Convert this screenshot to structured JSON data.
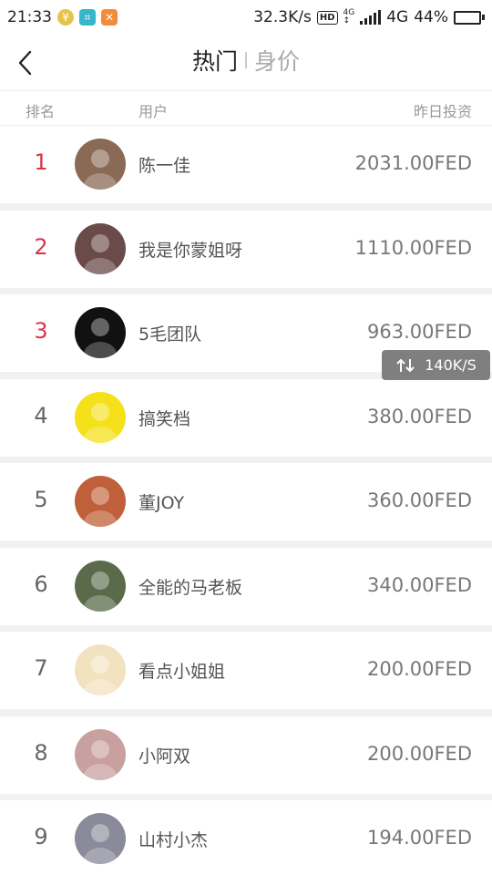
{
  "status": {
    "time": "21:33",
    "net_speed": "32.3K/s",
    "hd": "HD",
    "net_type": "4G",
    "battery": "44%",
    "battery_level": 0.44,
    "icons": [
      "coin-app-icon",
      "scan-app-icon",
      "tools-app-icon"
    ]
  },
  "header": {
    "tabs": [
      {
        "label": "热门",
        "active": true
      },
      {
        "label": "身价",
        "active": false
      }
    ]
  },
  "columns": {
    "rank": "排名",
    "user": "用户",
    "investment": "昨日投资"
  },
  "rows": [
    {
      "rank": "1",
      "name": "陈一佳",
      "amount": "2031.00FED",
      "avatar": "avatar-woman-icon",
      "avatar_color": "#8a6a55"
    },
    {
      "rank": "2",
      "name": "我是你蒙姐呀",
      "amount": "1110.00FED",
      "avatar": "avatar-woman-icon",
      "avatar_color": "#6b4a4a"
    },
    {
      "rank": "3",
      "name": "5毛团队",
      "amount": "963.00FED",
      "avatar": "logo-5mao-icon",
      "avatar_color": "#111111"
    },
    {
      "rank": "4",
      "name": "搞笑档",
      "amount": "380.00FED",
      "avatar": "logo-funny-icon",
      "avatar_color": "#f4e11a"
    },
    {
      "rank": "5",
      "name": "董JOY",
      "amount": "360.00FED",
      "avatar": "avatar-woman-icon",
      "avatar_color": "#c0603a"
    },
    {
      "rank": "6",
      "name": "全能的马老板",
      "amount": "340.00FED",
      "avatar": "avatar-man-icon",
      "avatar_color": "#5a6a4a"
    },
    {
      "rank": "7",
      "name": "看点小姐姐",
      "amount": "200.00FED",
      "avatar": "avatar-woman-icon",
      "avatar_color": "#f3e2c0"
    },
    {
      "rank": "8",
      "name": "小阿双",
      "amount": "200.00FED",
      "avatar": "avatar-woman-icon",
      "avatar_color": "#c9a0a0"
    },
    {
      "rank": "9",
      "name": "山村小杰",
      "amount": "194.00FED",
      "avatar": "avatar-couple-icon",
      "avatar_color": "#8a8a9a"
    }
  ],
  "overlay": {
    "speed": "140K/S"
  }
}
